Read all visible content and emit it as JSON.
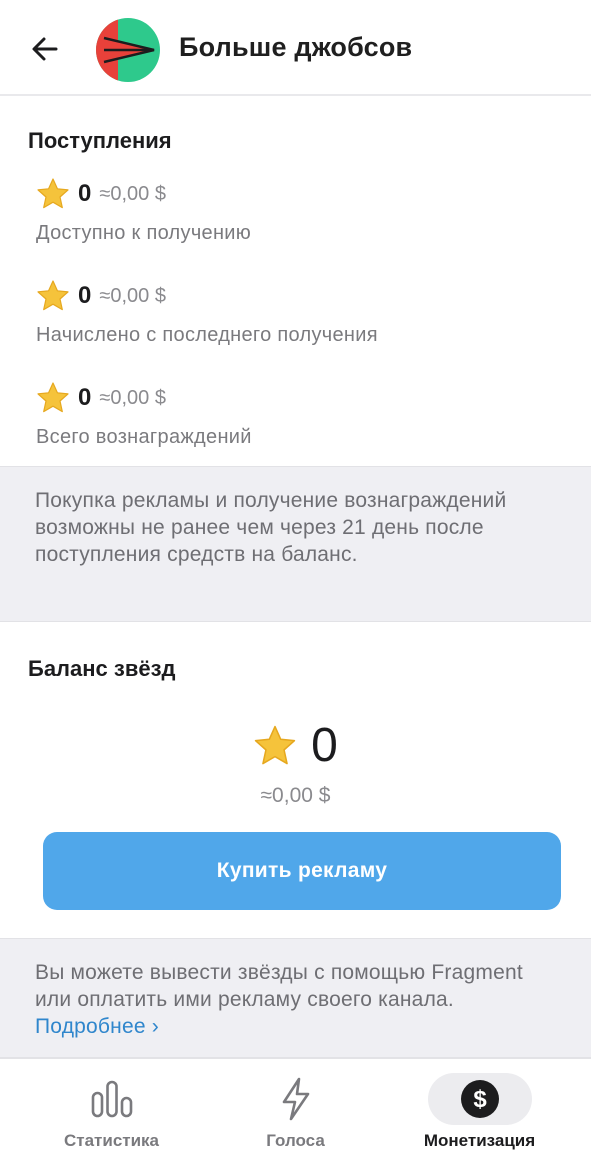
{
  "header": {
    "title": "Больше джобсов",
    "back_icon": "arrow-left-icon",
    "avatar_colors": {
      "left": "#e8413a",
      "right": "#2ec98c",
      "arrow": "#1c1c1e"
    }
  },
  "income": {
    "title": "Поступления",
    "items": [
      {
        "amount": "0",
        "approx": "≈0,00 $",
        "caption": "Доступно к получению"
      },
      {
        "amount": "0",
        "approx": "≈0,00 $",
        "caption": "Начислено с последнего получения"
      },
      {
        "amount": "0",
        "approx": "≈0,00 $",
        "caption": "Всего вознаграждений"
      }
    ]
  },
  "notice_top": {
    "text": "Покупка рекламы и получение вознаграждений возможны не ранее чем через 21 день после поступления средств на баланс."
  },
  "balance": {
    "title": "Баланс звёзд",
    "value": "0",
    "approx": "≈0,00 $",
    "button_label": "Купить рекламу"
  },
  "notice_bottom": {
    "text": "Вы можете вывести звёзды с помощью Fragment или оплатить ими рекламу своего канала.",
    "link_label": "Подробнее ›"
  },
  "bottom_nav": {
    "items": [
      {
        "label": "Статистика",
        "icon": "bar-chart-icon",
        "active": false
      },
      {
        "label": "Голоса",
        "icon": "lightning-icon",
        "active": false
      },
      {
        "label": "Монетизация",
        "icon": "dollar-coin-icon",
        "active": true
      }
    ]
  },
  "colors": {
    "accent_button": "#50a7ea",
    "link": "#2f86cc",
    "star": "#f5c33b",
    "info_background": "#efeff3"
  }
}
